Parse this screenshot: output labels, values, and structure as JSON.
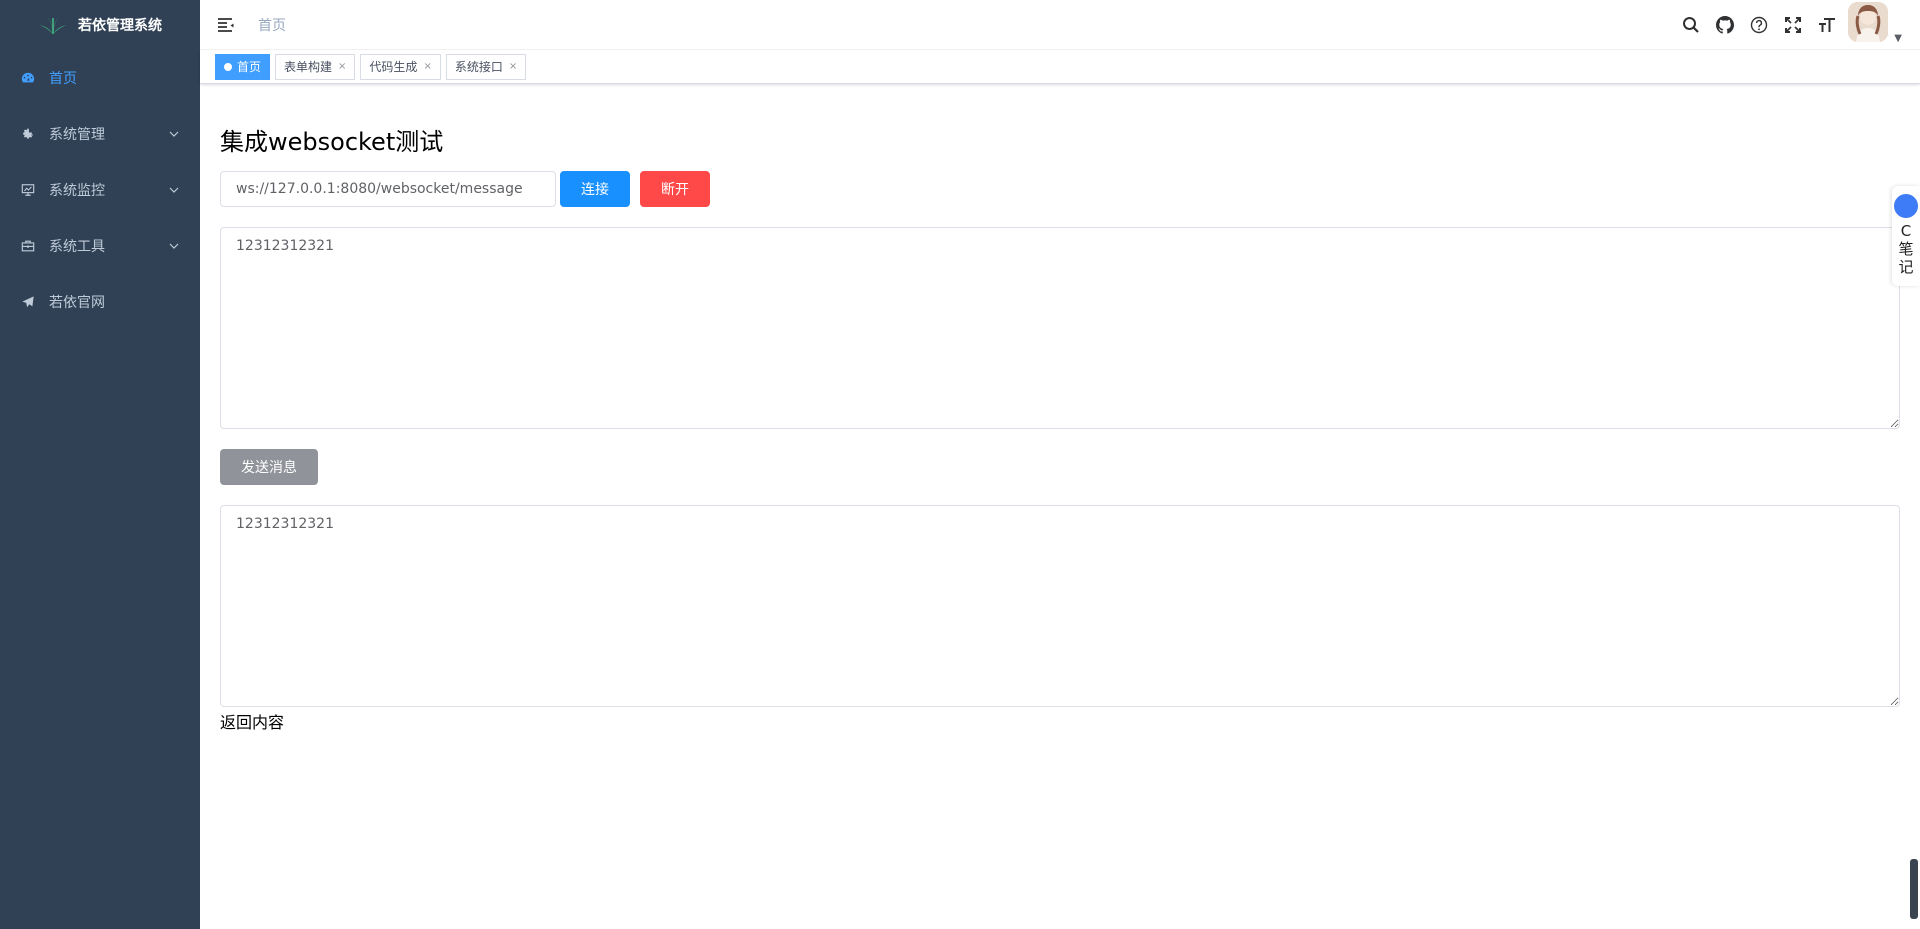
{
  "sidebar": {
    "title": "若依管理系统",
    "items": [
      {
        "label": "首页",
        "icon": "dashboard-icon",
        "active": true
      },
      {
        "label": "系统管理",
        "icon": "gear-icon",
        "active": false
      },
      {
        "label": "系统监控",
        "icon": "monitor-icon",
        "active": false
      },
      {
        "label": "系统工具",
        "icon": "toolbox-icon",
        "active": false
      },
      {
        "label": "若依官网",
        "icon": "paper-plane-icon",
        "active": false
      }
    ]
  },
  "navbar": {
    "breadcrumb": "首页"
  },
  "tags": [
    {
      "label": "首页",
      "active": true
    },
    {
      "label": "表单构建",
      "active": false,
      "close": "×"
    },
    {
      "label": "代码生成",
      "active": false,
      "close": "×"
    },
    {
      "label": "系统接口",
      "active": false,
      "close": "×"
    }
  ],
  "main": {
    "title": "集成websocket测试",
    "url_value": "ws://127.0.0.1:8080/websocket/message",
    "connect_label": "连接",
    "disconnect_label": "断开",
    "message_value": "12312312321",
    "send_label": "发送消息",
    "response_value": "12312312321",
    "response_label": "返回内容"
  },
  "float_widget": {
    "chars": [
      "C",
      "笔",
      "记"
    ]
  },
  "colors": {
    "sidebar_bg": "#304156",
    "primary": "#1890ff",
    "danger": "#ff4949",
    "info": "#909399",
    "active_menu": "#409eff"
  }
}
